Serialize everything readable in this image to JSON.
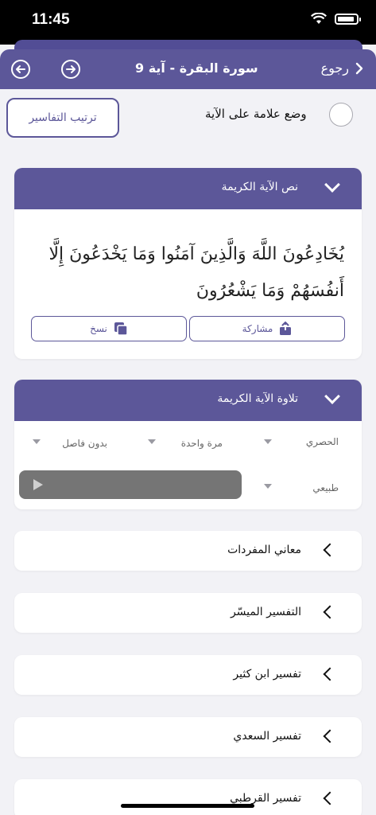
{
  "status_bar": {
    "time": "11:45"
  },
  "navbar": {
    "title": "سورة البقرة - آية 9",
    "back_label": "رجوع",
    "prev_icon": "arrow-left-circle-icon",
    "next_icon": "arrow-right-circle-icon"
  },
  "toolbar": {
    "sort_label": "ترتيب التفاسير",
    "bookmark_label": "وضع علامة على الآية"
  },
  "verse_card": {
    "title": "نص الآية الكريمة",
    "text": "يُخَادِعُونَ اللَّهَ وَالَّذِينَ آمَنُوا وَمَا يَخْدَعُونَ إِلَّا أَنفُسَهُمْ وَمَا يَشْعُرُونَ",
    "share_label": "مشاركة",
    "copy_label": "نسخ"
  },
  "recitation_card": {
    "title": "تلاوة الآية الكريمة",
    "reciter": "الحصري",
    "repeat": "مرة واحدة",
    "separator": "بدون فاصل",
    "speed": "طبيعي"
  },
  "tafsir_list": [
    {
      "label": "معاني المفردات"
    },
    {
      "label": "التفسير الميسّر"
    },
    {
      "label": "تفسير ابن كثير"
    },
    {
      "label": "تفسير السعدي"
    },
    {
      "label": "تفسير القرطبي"
    }
  ],
  "colors": {
    "primary": "#5c5799",
    "background": "#f2f2f6"
  }
}
